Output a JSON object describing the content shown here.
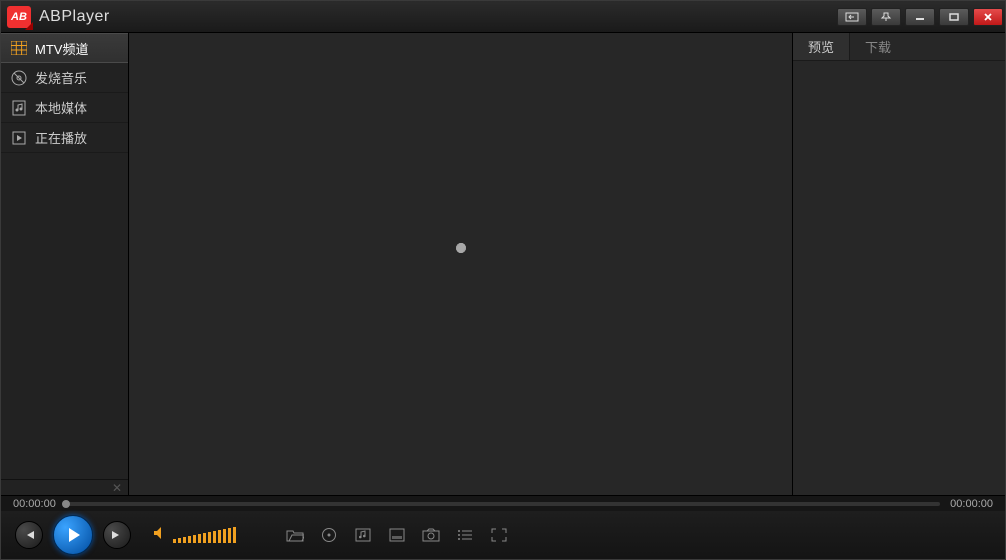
{
  "app_title": "ABPlayer",
  "sidebar": {
    "items": [
      {
        "label": "MTV频道",
        "icon": "grid-icon"
      },
      {
        "label": "发烧音乐",
        "icon": "disc-icon"
      },
      {
        "label": "本地媒体",
        "icon": "music-file-icon"
      },
      {
        "label": "正在播放",
        "icon": "play-box-icon"
      }
    ]
  },
  "right_panel": {
    "tabs": [
      {
        "label": "预览"
      },
      {
        "label": "下载"
      }
    ]
  },
  "time": {
    "current": "00:00:00",
    "total": "00:00:00"
  }
}
